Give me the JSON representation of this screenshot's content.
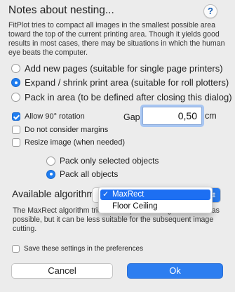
{
  "dialog": {
    "title": "Notes about nesting...",
    "help": "?",
    "description": "FitPlot tries to compact all images in the smallest possible area toward the top of the current printing area. Though it yields good results in most cases, there may be situations in which the human eye beats the computer."
  },
  "mode_options": [
    {
      "label": "Add new pages (suitable for single page printers)",
      "selected": false
    },
    {
      "label": "Expand / shrink print area (suitable for roll plotters)",
      "selected": true
    },
    {
      "label": "Pack in area (to be defined after closing this dialog)",
      "selected": false
    }
  ],
  "options": {
    "allow_rotation": {
      "label": "Allow 90° rotation",
      "checked": true
    },
    "no_margins": {
      "label": "Do not consider margins",
      "checked": false
    },
    "resize": {
      "label": "Resize image (when needed)",
      "checked": false
    }
  },
  "gap": {
    "label": "Gap",
    "value": "0,50",
    "unit": "cm"
  },
  "pack_options": [
    {
      "label": "Pack only selected objects",
      "selected": false
    },
    {
      "label": "Pack all objects",
      "selected": true
    }
  ],
  "algorithms": {
    "label": "Available algorithms",
    "selected": "MaxRect",
    "items": [
      "MaxRect",
      "Floor Ceiling"
    ],
    "check_mark": "✓",
    "description": "The MaxRect algorithm tries to compact all images as much as possible, but it can be less suitable for the subsequent image cutting."
  },
  "save_settings": {
    "label": "Save these settings in the preferences",
    "checked": false
  },
  "buttons": {
    "cancel": "Cancel",
    "ok": "Ok"
  },
  "colors": {
    "accent": "#1f7df0",
    "background": "#ececec"
  }
}
